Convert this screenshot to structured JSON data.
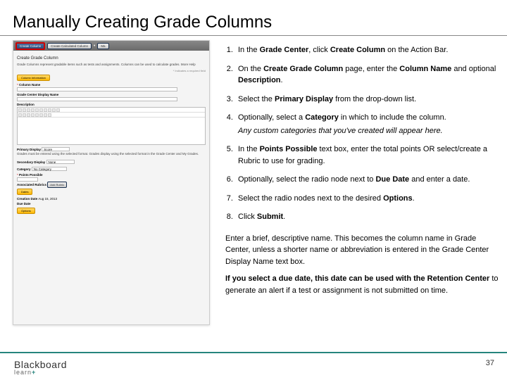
{
  "title": "Manually Creating Grade Columns",
  "thumb": {
    "toolbar": {
      "create_column": "Create Column",
      "create_calculated": "Create Calculated Column",
      "manage": "Ma"
    },
    "heading": "Create Grade Column",
    "blurb": "Grade Columns represent gradable items such as tests and assignments. Columns can be used to calculate grades. More Help",
    "tag_info": "Column Information",
    "label_col_name": "Column Name",
    "label_display_name": "Grade Center Display Name",
    "label_description": "Description",
    "label_primary": "Primary Display",
    "primary_hint": "Grades must be entered using the selected format. Grades display using the selected format in the Grade Center and My Grades.",
    "sel_score": "Score",
    "label_secondary": "Secondary Display",
    "sel_none": "None",
    "label_category": "Category",
    "sel_nocat": "No Category",
    "label_points": "Points Possible",
    "label_rubrics": "Associated Rubrics",
    "btn_add_rubric": "Add Rubric",
    "tag_dates": "Dates",
    "label_created": "Creation Date",
    "val_created": "Aug 15, 2013",
    "label_due": "Due Date",
    "tag_options": "Options"
  },
  "steps": [
    {
      "t": "In the <b>Grade Center</b>, click <b>Create Column</b> on the Action Bar."
    },
    {
      "t": "On the <b>Create Grade Column</b> page, enter the <b>Column Name</b> and optional <b>Description</b>."
    },
    {
      "t": "Select the <b>Primary Display</b> from the drop-down list."
    },
    {
      "t": "Optionally, select a <b>Category</b> in which to include the column.",
      "n": "Any custom categories that you've created will appear here."
    },
    {
      "t": "In the <b>Points Possible</b> text box, enter the total points OR select/create a Rubric to use for grading."
    },
    {
      "t": "Optionally, select the radio node next to <b>Due Date</b> and enter a date."
    },
    {
      "t": "Select the radio nodes next to the desired <b>Options</b>."
    },
    {
      "t": "Click <b>Submit</b>."
    }
  ],
  "paragraphs": [
    "Enter a brief, descriptive name. This becomes the column name in Grade Center, unless a shorter name or abbreviation is entered in the Grade Center Display Name text box.",
    "<b>If you select a due date, this date can be used with the Retention Center</b> to generate an alert if a test or assignment is not submitted on time."
  ],
  "logo": {
    "brand": "Blackboard",
    "product": "learn",
    "plus": "+"
  },
  "page_number": "37"
}
